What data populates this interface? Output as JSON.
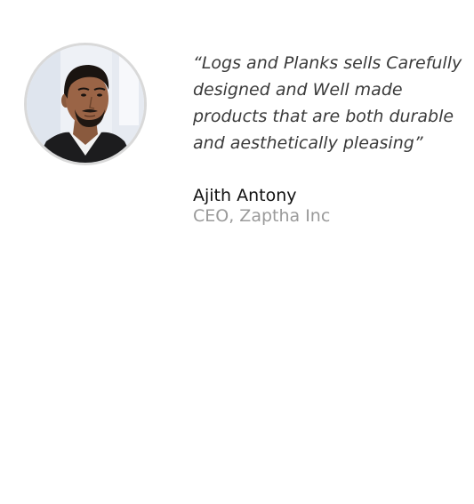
{
  "testimonial": {
    "quote": "“Logs and Planks sells Carefully designed and Well made products that are both durable and aesthetically pleasing”",
    "author_name": "Ajith Antony",
    "author_title": "CEO, Zaptha Inc",
    "avatar_icon": "person-photo-avatar"
  }
}
